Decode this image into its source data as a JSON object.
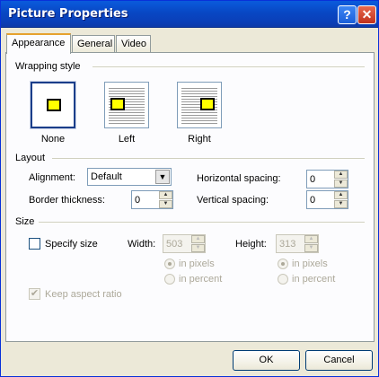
{
  "window": {
    "title": "Picture Properties",
    "help_symbol": "?",
    "close_symbol": "✕"
  },
  "tabs": [
    {
      "label": "Appearance",
      "active": true
    },
    {
      "label": "General",
      "active": false
    },
    {
      "label": "Video",
      "active": false
    }
  ],
  "wrapping": {
    "group_label": "Wrapping style",
    "options": [
      {
        "label": "None",
        "selected": true
      },
      {
        "label": "Left",
        "selected": false
      },
      {
        "label": "Right",
        "selected": false
      }
    ]
  },
  "layout": {
    "group_label": "Layout",
    "alignment_label": "Alignment:",
    "alignment_value": "Default",
    "border_label": "Border thickness:",
    "border_value": "0",
    "hspacing_label": "Horizontal spacing:",
    "hspacing_value": "0",
    "vspacing_label": "Vertical spacing:",
    "vspacing_value": "0"
  },
  "size": {
    "group_label": "Size",
    "specify_label": "Specify size",
    "specify_checked": false,
    "width_label": "Width:",
    "width_value": "503",
    "height_label": "Height:",
    "height_value": "313",
    "in_pixels": "in pixels",
    "in_percent": "in percent",
    "keep_aspect_label": "Keep aspect ratio",
    "keep_aspect_checked": true
  },
  "buttons": {
    "ok": "OK",
    "cancel": "Cancel"
  },
  "icons": {
    "dropdown": "▼",
    "spin_up": "▲",
    "spin_down": "▼",
    "check": "✔"
  }
}
